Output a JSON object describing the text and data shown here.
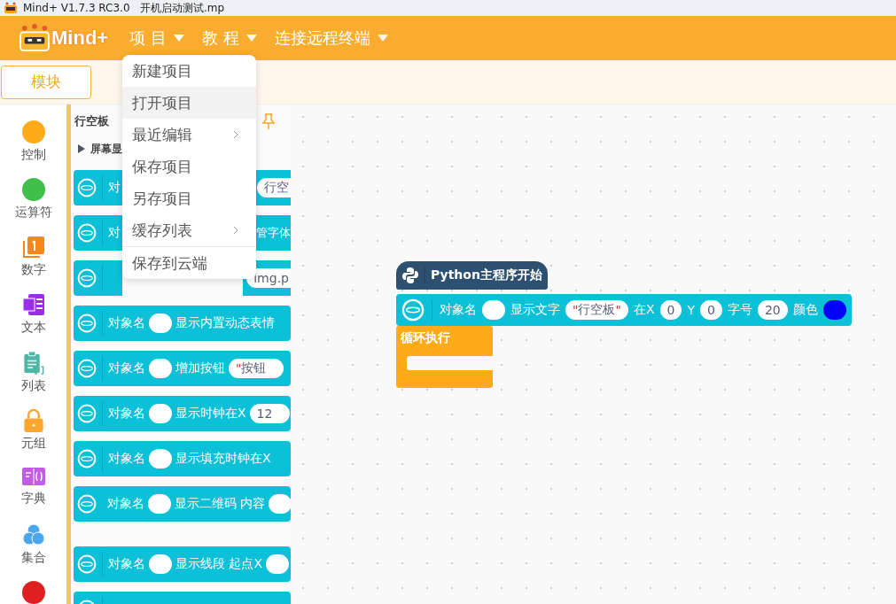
{
  "window": {
    "title": "Mind+ V1.7.3 RC3.0   开机启动测试.mp"
  },
  "header": {
    "logo": "Mind+",
    "menus": [
      {
        "label": "项 目",
        "open": true
      },
      {
        "label": "教 程",
        "open": false
      },
      {
        "label": "连接远程终端",
        "open": false
      }
    ]
  },
  "dropdown": [
    {
      "kind": "item",
      "label": "新建项目",
      "highlighted": false,
      "submenu": false
    },
    {
      "kind": "item",
      "label": "打开项目",
      "highlighted": true,
      "submenu": false
    },
    {
      "kind": "item",
      "label": "最近编辑",
      "highlighted": false,
      "submenu": true
    },
    {
      "kind": "item",
      "label": "保存项目",
      "highlighted": false,
      "submenu": false
    },
    {
      "kind": "item",
      "label": "另存项目",
      "highlighted": false,
      "submenu": false
    },
    {
      "kind": "item",
      "label": "缓存列表",
      "highlighted": false,
      "submenu": true
    },
    {
      "kind": "separator"
    },
    {
      "kind": "item",
      "label": "保存到云端",
      "highlighted": false,
      "submenu": false
    }
  ],
  "tabs": [
    {
      "label": "模块",
      "selected": true
    }
  ],
  "categories": [
    {
      "kind": "circle",
      "label": "控制",
      "color": "#ffab19"
    },
    {
      "kind": "circle",
      "label": "运算符",
      "color": "#40bf4a"
    },
    {
      "kind": "number",
      "label": "数字",
      "color": "#f7861c"
    },
    {
      "kind": "text",
      "label": "文本",
      "color": "#9a2ee8"
    },
    {
      "kind": "list",
      "label": "列表",
      "color": "#4fb6a6"
    },
    {
      "kind": "tuple",
      "label": "元组",
      "color": "#ffa630"
    },
    {
      "kind": "dict",
      "label": "字典",
      "color": "#c25ce8"
    },
    {
      "kind": "set",
      "label": "集合",
      "color": "#4aa6ee"
    },
    {
      "kind": "circle",
      "color": "#e02020"
    }
  ],
  "palette": {
    "title": "行空板",
    "section": "屏幕显",
    "blocks": [
      {
        "parts": [
          {
            "kind": "text",
            "text": "对"
          },
          {
            "kind": "field",
            "value": "行空",
            "far": true
          }
        ]
      },
      {
        "parts": [
          {
            "kind": "text",
            "text": "对"
          },
          {
            "kind": "text",
            "text": "管字体",
            "far": true
          }
        ]
      },
      {
        "parts": [
          {
            "kind": "field",
            "value": "img.p",
            "far": true
          }
        ]
      },
      {
        "parts": [
          {
            "kind": "text",
            "text": "对象名"
          },
          {
            "kind": "slot"
          },
          {
            "kind": "text",
            "text": "显示内置动态表情"
          }
        ]
      },
      {
        "parts": [
          {
            "kind": "text",
            "text": "对象名"
          },
          {
            "kind": "slot"
          },
          {
            "kind": "text",
            "text": "增加按钮"
          },
          {
            "kind": "string",
            "open": "\"",
            "value": "按钮"
          }
        ]
      },
      {
        "parts": [
          {
            "kind": "text",
            "text": "对象名"
          },
          {
            "kind": "slot"
          },
          {
            "kind": "text",
            "text": "显示时钟在X"
          },
          {
            "kind": "field",
            "value": "12"
          }
        ]
      },
      {
        "parts": [
          {
            "kind": "text",
            "text": "对象名"
          },
          {
            "kind": "slot"
          },
          {
            "kind": "text",
            "text": "显示填充时钟在X"
          }
        ]
      },
      {
        "parts": [
          {
            "kind": "text",
            "text": "对象名"
          },
          {
            "kind": "slot"
          },
          {
            "kind": "text",
            "text": "显示二维码 内容"
          },
          {
            "kind": "slot"
          }
        ]
      },
      {
        "parts": [
          {
            "kind": "text",
            "text": "对象名"
          },
          {
            "kind": "slot"
          },
          {
            "kind": "text",
            "text": "显示线段 起点X"
          },
          {
            "kind": "slot"
          }
        ]
      },
      {
        "cut": true
      }
    ]
  },
  "script": {
    "hat": "Python主程序开始",
    "statement": [
      {
        "kind": "text",
        "text": "对象名"
      },
      {
        "kind": "slot"
      },
      {
        "kind": "text",
        "text": "显示文字"
      },
      {
        "kind": "string",
        "open": "\"",
        "value": "行空板",
        "close": "\""
      },
      {
        "kind": "text",
        "text": "在X"
      },
      {
        "kind": "field",
        "value": "0"
      },
      {
        "kind": "text",
        "text": "Y"
      },
      {
        "kind": "field",
        "value": "0"
      },
      {
        "kind": "text",
        "text": "字号"
      },
      {
        "kind": "field",
        "value": "20"
      },
      {
        "kind": "text",
        "text": "颜色"
      },
      {
        "kind": "color",
        "color": "#0000ff"
      }
    ],
    "loop": "循环执行"
  }
}
